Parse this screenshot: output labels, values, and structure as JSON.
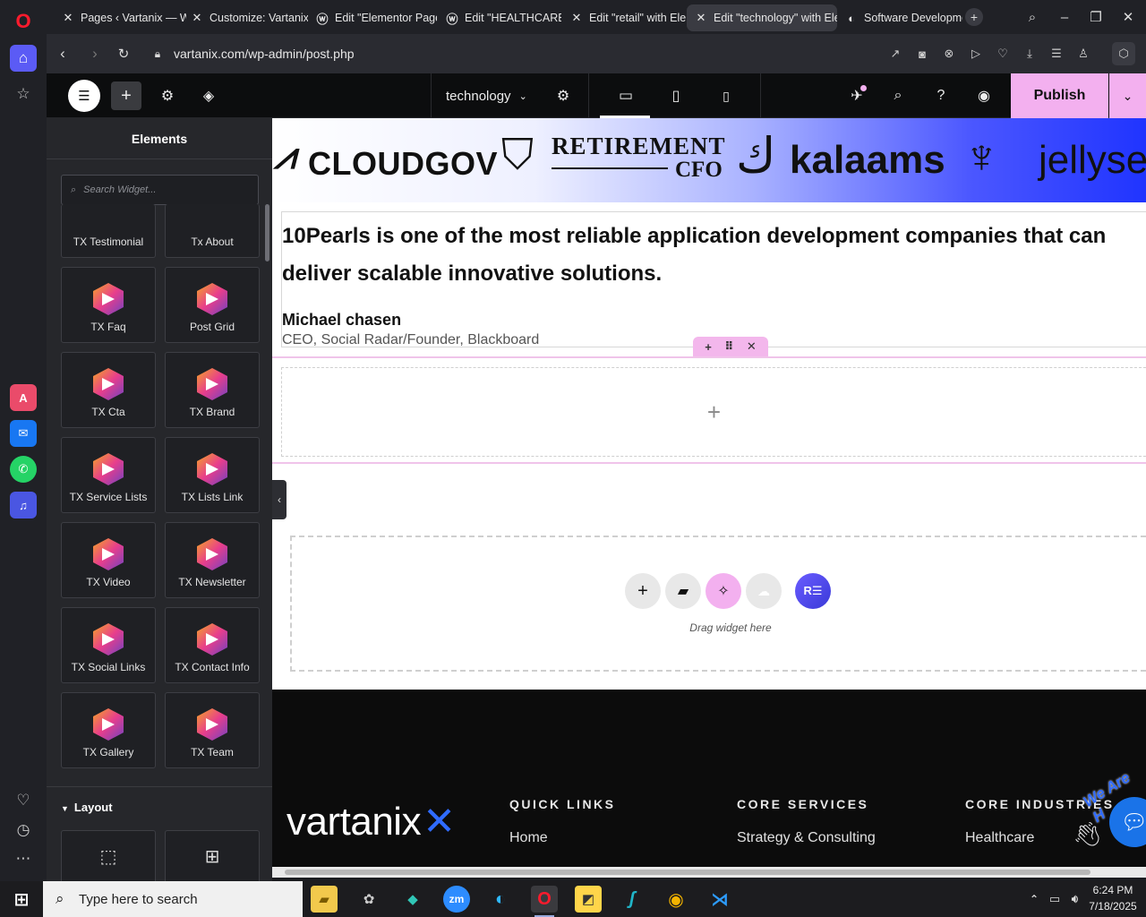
{
  "browser": {
    "tabs": [
      {
        "title": "Pages ‹ Vartanix — W",
        "icon": "elementor-x-icon"
      },
      {
        "title": "Customize: Vartanix |",
        "icon": "elementor-x-icon"
      },
      {
        "title": "Edit \"Elementor Page",
        "icon": "wordpress-icon"
      },
      {
        "title": "Edit \"HEALTHCARE\"",
        "icon": "wordpress-icon"
      },
      {
        "title": "Edit \"retail\" with Elen",
        "icon": "elementor-x-icon"
      },
      {
        "title": "Edit \"technology\" with Ele",
        "icon": "elementor-x-icon"
      },
      {
        "title": "Software Developme",
        "icon": "vartanix-c-icon"
      }
    ],
    "url": "vartanix.com/wp-admin/post.php"
  },
  "editor": {
    "page_name": "technology",
    "publish_label": "Publish",
    "panel_title": "Elements",
    "search_placeholder": "Search Widget...",
    "widgets": [
      "TX Testimonial",
      "Tx About",
      "TX Faq",
      "Post Grid",
      "TX Cta",
      "TX Brand",
      "TX Service Lists",
      "TX Lists Link",
      "TX Video",
      "TX Newsletter",
      "TX Social Links",
      "TX Contact Info",
      "TX Gallery",
      "TX Team"
    ],
    "layout_section": "Layout"
  },
  "canvas": {
    "logos": [
      "CLOUDGOV",
      "RETIREMENT",
      "CFO",
      "kalaams",
      "jellyse"
    ],
    "quote": "10Pearls is one of the most reliable application development companies that can deliver scalable innovative solutions.",
    "author": "Michael chasen",
    "role": "CEO, Social Radar/Founder, Blackboard",
    "drag_text": "Drag widget here",
    "footer": {
      "brand": "vartanix",
      "badge": "We Are H",
      "columns": [
        {
          "heading": "QUICK LINKS",
          "first": "Home"
        },
        {
          "heading": "CORE SERVICES",
          "first": "Strategy & Consulting"
        },
        {
          "heading": "CORE INDUSTRIES",
          "first": "Healthcare"
        }
      ]
    }
  },
  "taskbar": {
    "search_placeholder": "Type here to search",
    "time": "6:24 PM",
    "date": "7/18/2025"
  },
  "colors": {
    "accent_pink": "#f3b7ec",
    "publish_bg": "#f3b0ef",
    "opera_red": "#ff1b2d"
  }
}
